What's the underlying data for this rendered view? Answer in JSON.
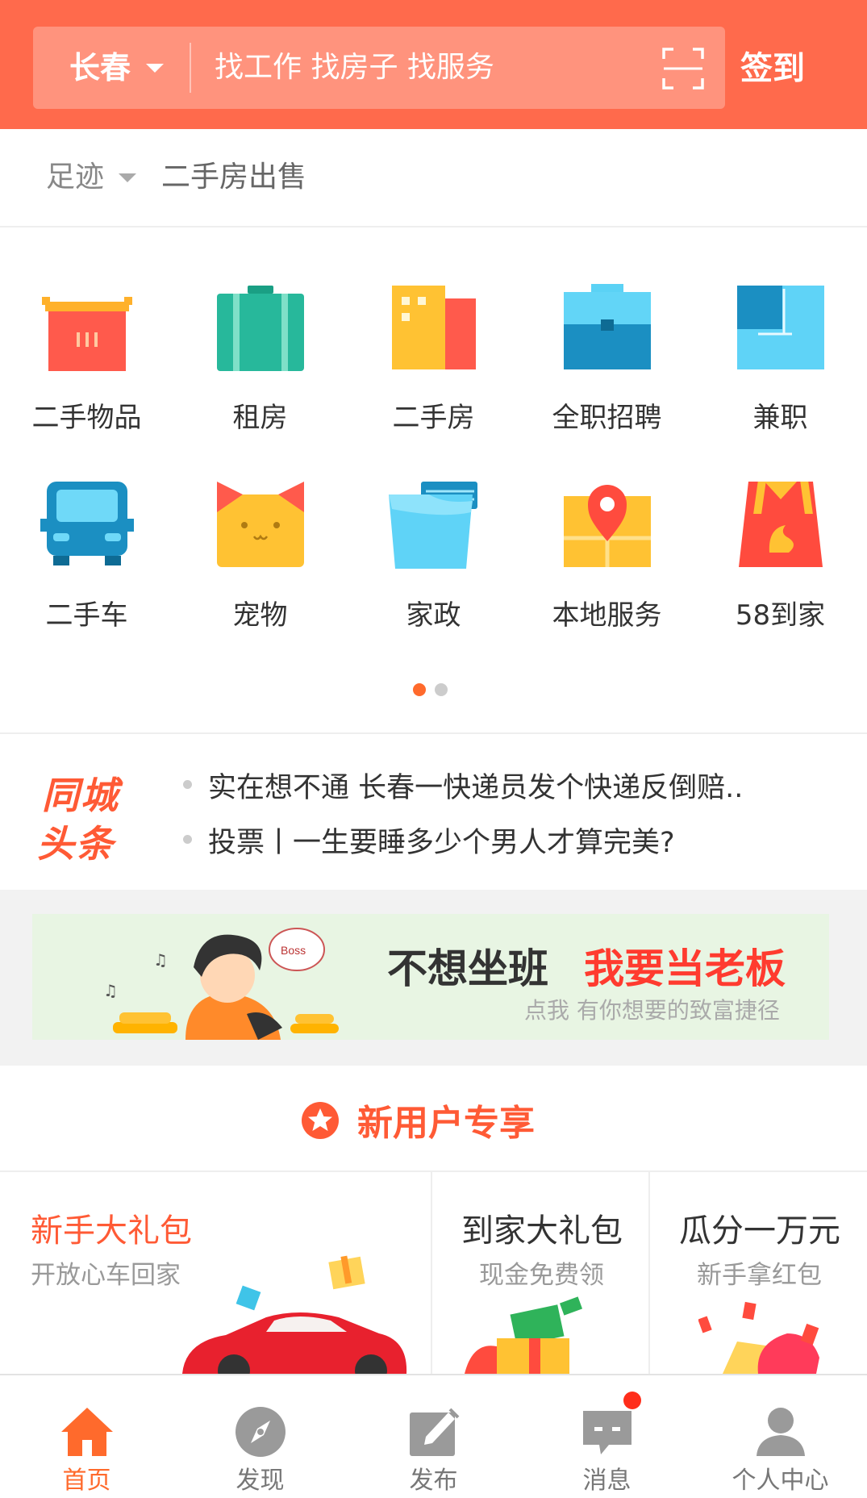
{
  "header": {
    "city": "长春",
    "search_placeholder": "找工作 找房子 找服务",
    "checkin": "签到"
  },
  "footprint": {
    "label": "足迹",
    "item": "二手房出售"
  },
  "categories": [
    {
      "label": "二手物品",
      "icon": "basket-icon"
    },
    {
      "label": "租房",
      "icon": "suitcase-icon"
    },
    {
      "label": "二手房",
      "icon": "building-icon"
    },
    {
      "label": "全职招聘",
      "icon": "briefcase-icon"
    },
    {
      "label": "兼职",
      "icon": "window-icon"
    },
    {
      "label": "二手车",
      "icon": "car-icon"
    },
    {
      "label": "宠物",
      "icon": "cat-icon"
    },
    {
      "label": "家政",
      "icon": "bucket-icon"
    },
    {
      "label": "本地服务",
      "icon": "map-pin-icon"
    },
    {
      "label": "58到家",
      "icon": "bag-icon"
    }
  ],
  "headlines": {
    "logo_line1": "同城",
    "logo_line2": "头条",
    "items": [
      "实在想不通 长春一快递员发个快递反倒赔..",
      "投票丨一生要睡多少个男人才算完美?"
    ]
  },
  "banner": {
    "title_dark": "不想坐班",
    "title_red": "我要当老板",
    "subtitle": "点我 有你想要的致富捷径",
    "bubble": "Boss"
  },
  "new_user": {
    "title": "新用户专享",
    "cards": [
      {
        "title": "新手大礼包",
        "subtitle": "开放心车回家"
      },
      {
        "title": "到家大礼包",
        "subtitle": "现金免费领"
      },
      {
        "title": "瓜分一万元",
        "subtitle": "新手拿红包"
      }
    ]
  },
  "tabbar": [
    {
      "label": "首页",
      "active": true
    },
    {
      "label": "发现"
    },
    {
      "label": "发布"
    },
    {
      "label": "消息",
      "badge": true
    },
    {
      "label": "个人中心"
    }
  ],
  "colors": {
    "accent": "#ff6a4c",
    "red_text": "#ff5a35",
    "active_tab": "#ff6a2c"
  }
}
